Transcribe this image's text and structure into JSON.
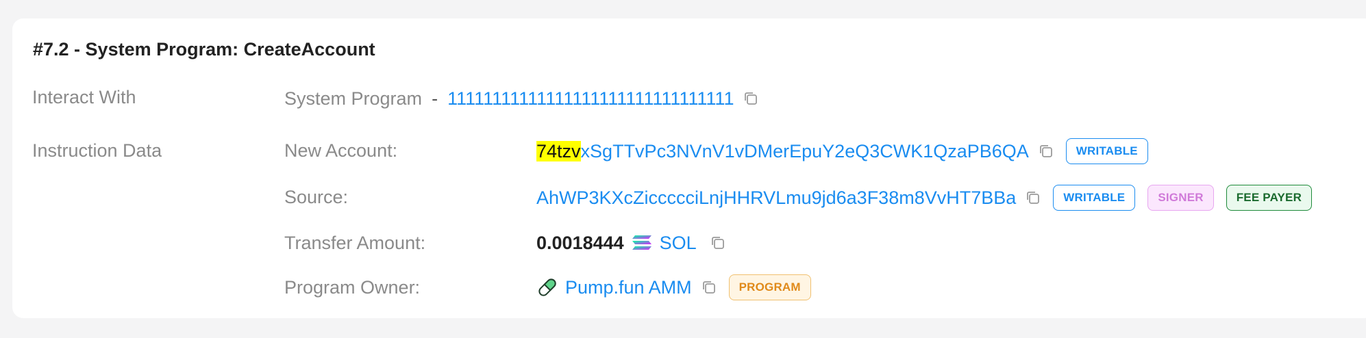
{
  "title": "#7.2 - System Program: CreateAccount",
  "interact_with": {
    "label": "Interact With",
    "program_name": "System Program",
    "separator": "-",
    "program_address": "11111111111111111111111111111111"
  },
  "instruction_data": {
    "label": "Instruction Data",
    "new_account": {
      "label": "New Account:",
      "address_highlight": "74tzv",
      "address_rest": "xSgTTvPc3NVnV1vDMerEpuY2eQ3CWK1QzaPB6QA",
      "badges": [
        "WRITABLE"
      ]
    },
    "source": {
      "label": "Source:",
      "address": "AhWP3KXcZiccccciLnjHHRVLmu9jd6a3F38m8VvHT7BBa",
      "badges": [
        "WRITABLE",
        "SIGNER",
        "FEE PAYER"
      ]
    },
    "transfer_amount": {
      "label": "Transfer Amount:",
      "value": "0.0018444",
      "token": "SOL",
      "token_icon": "solana-icon"
    },
    "program_owner": {
      "label": "Program Owner:",
      "name": "Pump.fun AMM",
      "icon": "pill-icon",
      "badges": [
        "PROGRAM"
      ]
    }
  },
  "colors": {
    "link": "#1a8cf0",
    "highlight": "#ffff00",
    "label": "#8a8a8a",
    "title": "#222222"
  }
}
